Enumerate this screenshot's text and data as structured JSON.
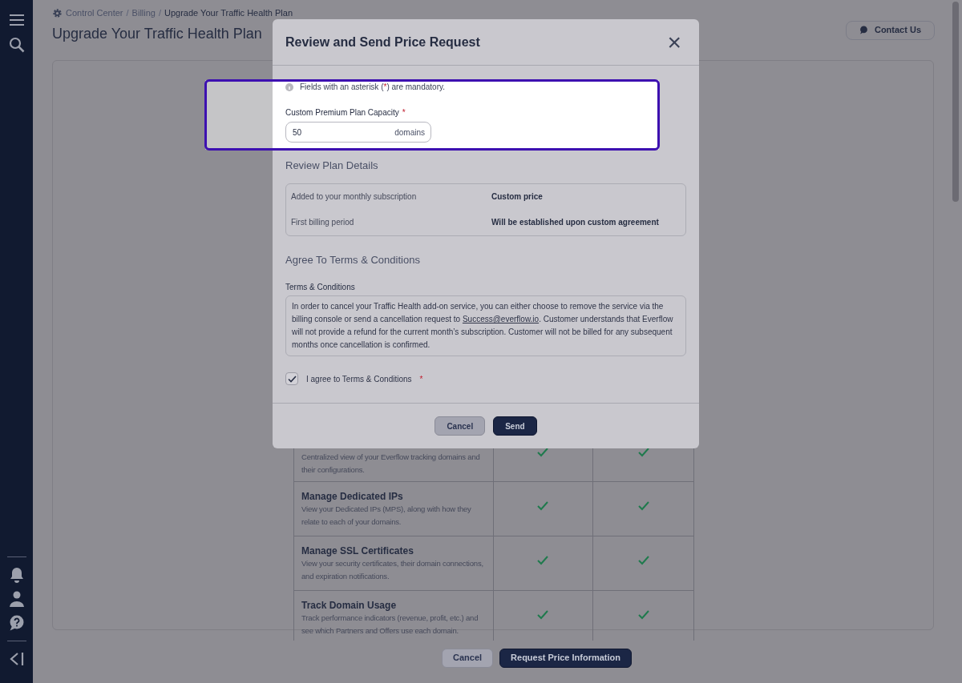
{
  "breadcrumb": [
    {
      "kind": "link",
      "text": "Control Center"
    },
    {
      "kind": "separator",
      "text": "/"
    },
    {
      "kind": "link",
      "text": "Billing"
    },
    {
      "kind": "separator",
      "text": "/"
    },
    {
      "kind": "current",
      "text": "Upgrade Your Traffic Health Plan"
    }
  ],
  "page_title": "Upgrade Your Traffic Health Plan",
  "contact_button": "Contact Us",
  "features": [
    {
      "description": "Centralized view of your Everflow tracking domains and their configurations.",
      "column_2": true,
      "column_3": true
    },
    {
      "title": "Manage Dedicated IPs",
      "description": "View your Dedicated IPs (MPS), along with how they relate to each of your domains.",
      "column_2": true,
      "column_3": true
    },
    {
      "title": "Manage SSL Certificates",
      "description": "View your security certificates, their domain connections, and expiration notifications.",
      "column_2": true,
      "column_3": true
    },
    {
      "title": "Track Domain Usage",
      "description": "Track performance indicators (revenue, profit, etc.) and see which Partners and Offers use each domain.",
      "column_2": true,
      "column_3": true
    }
  ],
  "footer_buttons": [
    {
      "label": "Cancel",
      "kind": "secondary"
    },
    {
      "label": "Request Price Information",
      "kind": "primary"
    }
  ],
  "modal": {
    "title": "Review and Send Price Request",
    "close": "×",
    "note": {
      "before": "Fields with an asterisk (",
      "mark": "*",
      "after": ") are mandatory."
    },
    "capacity_field": {
      "label": "Custom Premium Plan Capacity",
      "required": true,
      "value": "50",
      "suffix": "domains"
    },
    "review_heading": "Review Plan Details",
    "details": [
      {
        "label": "Added to your monthly subscription",
        "value": "Custom price"
      },
      {
        "label": "First billing period",
        "value": "Will be established upon custom agreement"
      }
    ],
    "terms_heading": "Agree To Terms & Conditions",
    "terms_label": "Terms & Conditions",
    "terms_text": {
      "before": "In order to cancel your Traffic Health add-on service, you can either choose to remove the service via the billing console or send a cancellation request to ",
      "link": "Success@everflow.io",
      "after": ".  Customer understands that Everflow will not provide a refund for the current month’s subscription. Customer will not be billed for any subsequent months once cancellation is confirmed."
    },
    "agree": {
      "label": "I agree to Terms & Conditions",
      "checked": true,
      "required": true
    },
    "buttons": [
      {
        "label": "Cancel",
        "kind": "secondary"
      },
      {
        "label": "Send",
        "kind": "primary"
      }
    ]
  }
}
